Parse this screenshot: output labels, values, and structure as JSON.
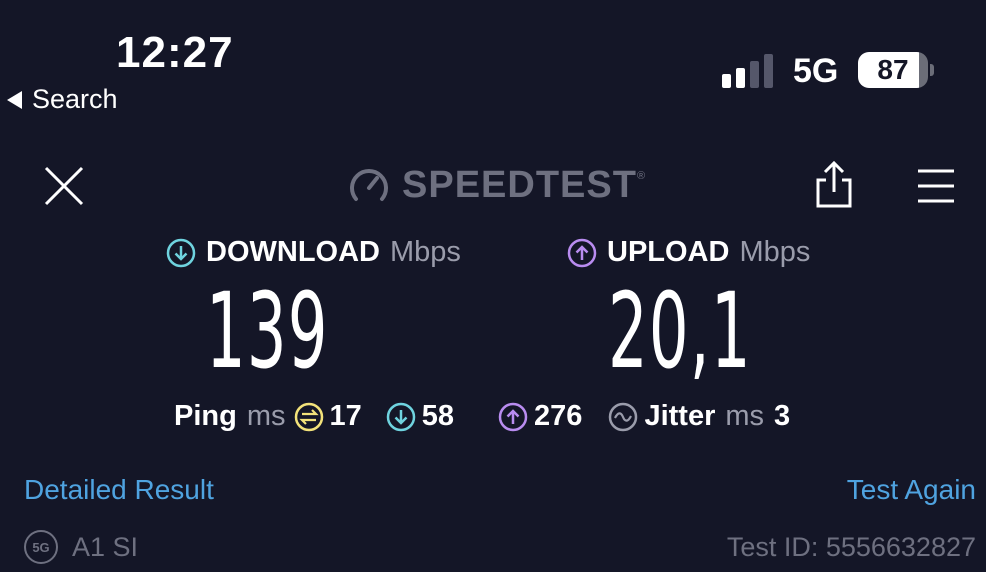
{
  "status_bar": {
    "time": "12:27",
    "back_label": "Search",
    "network": "5G",
    "battery": "87",
    "signal_bars_active": 2,
    "signal_bars_total": 4
  },
  "header": {
    "logo_text": "SPEEDTEST",
    "logo_tm": "®"
  },
  "download": {
    "label": "DOWNLOAD",
    "unit": "Mbps",
    "value": "139"
  },
  "upload": {
    "label": "UPLOAD",
    "unit": "Mbps",
    "value": "20,1"
  },
  "stats": {
    "ping_label": "Ping",
    "ping_unit": "ms",
    "idle_ping": "17",
    "download_ping": "58",
    "upload_ping": "276",
    "jitter_label": "Jitter",
    "jitter_unit": "ms",
    "jitter": "3"
  },
  "footer": {
    "detailed_result": "Detailed Result",
    "test_again": "Test Again",
    "server_badge": "5G",
    "server_name": "A1 SI",
    "test_id": "Test ID: 5556632827"
  },
  "colors": {
    "background": "#141627",
    "download_accent": "#6fd3df",
    "upload_accent": "#b98cf0",
    "idle_ping_accent": "#f3e27a",
    "link": "#4fa3e0",
    "muted": "#9a9cab"
  }
}
